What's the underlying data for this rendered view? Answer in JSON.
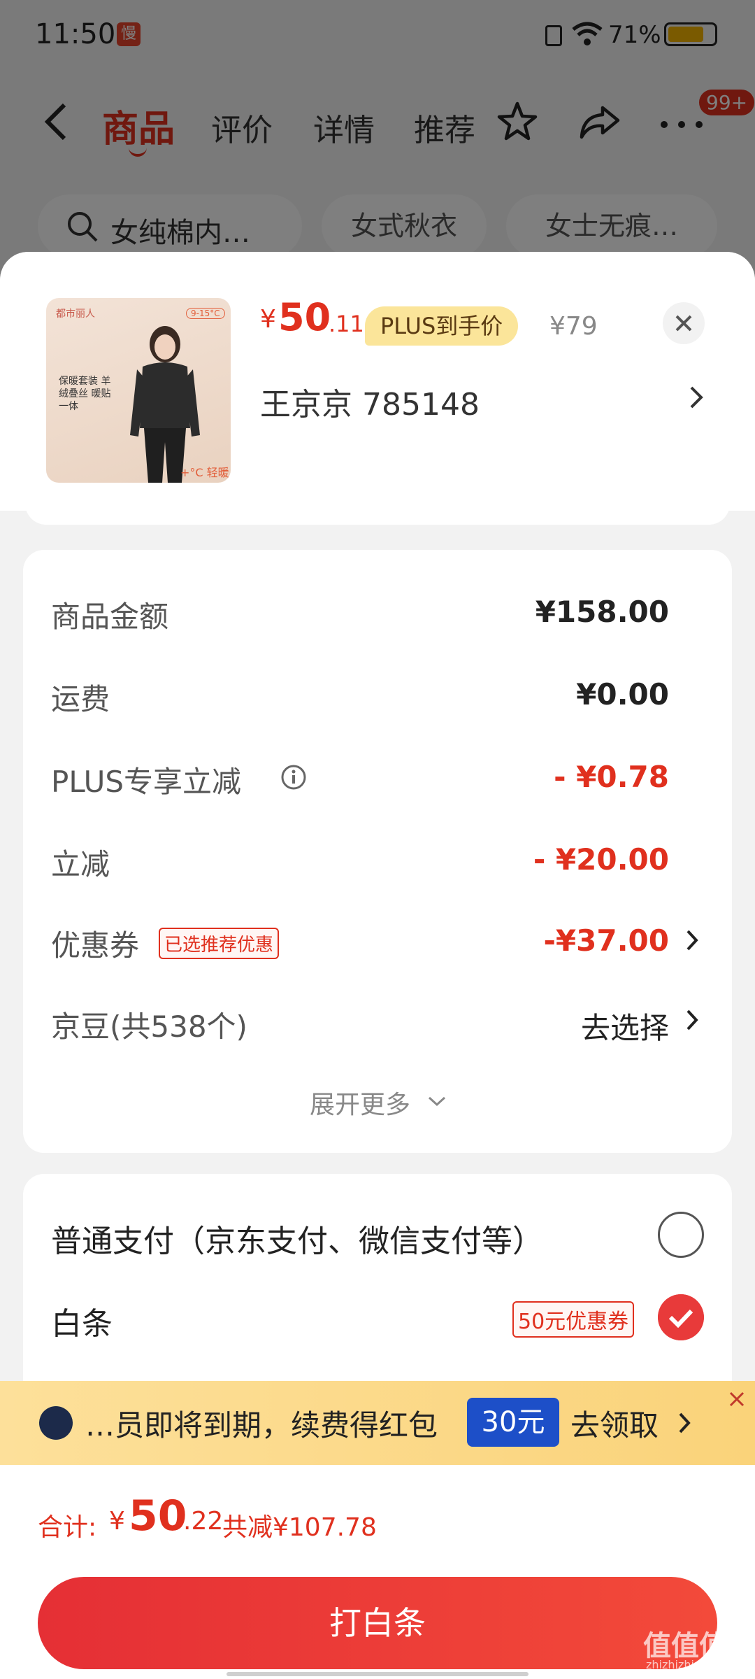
{
  "status_bar": {
    "time": "11:50",
    "badge": "慢",
    "battery": "71%"
  },
  "nav": {
    "tabs": [
      "商品",
      "评价",
      "详情",
      "推荐"
    ],
    "more_badge": "99+"
  },
  "search": {
    "query": "女纯棉内…",
    "chips": [
      "女式秋衣",
      "女士无痕…"
    ]
  },
  "product": {
    "thumb_brand": "都市丽人",
    "thumb_temp": "9-15°C",
    "thumb_tag": "保暖套装 羊绒叠丝 暖贴一体",
    "thumb_warm": "+°C 轻暖",
    "price_currency": "¥",
    "price_int": "50",
    "price_dec": ".11",
    "plus_badge": "PLUS到手价",
    "original_price": "¥79",
    "address": "王京京  785148"
  },
  "fees": {
    "goods_label": "商品金额",
    "goods_value": "¥158.00",
    "shipping_label": "运费",
    "shipping_value": "¥0.00",
    "plus_label": "PLUS专享立减",
    "plus_value": "- ¥0.78",
    "discount_label": "立减",
    "discount_value": "- ¥20.00",
    "coupon_label": "优惠券",
    "coupon_tag": "已选推荐优惠",
    "coupon_value": "-¥37.00",
    "jingdou_label": "京豆(共538个)",
    "jingdou_value": "去选择",
    "expand_more": "展开更多"
  },
  "payment": {
    "normal_label": "普通支付（京东支付、微信支付等）",
    "baitiao_label": "白条",
    "baitiao_coupon": "50元优惠券"
  },
  "banner": {
    "text": "…员即将到期，续费得红包",
    "amount": "30元",
    "cta": "去领取"
  },
  "footer": {
    "total_label": "合计:",
    "total_currency": "¥",
    "total_int": "50",
    "total_dec": ".22",
    "saved": "共减¥107.78",
    "pay_button": "打白条"
  },
  "watermark": {
    "text": "值值值",
    "sub": "zhizhizhi.com"
  },
  "colors": {
    "accent_red": "#e0301e",
    "plus_gold": "#fbe59a",
    "banner_blue": "#1d4fc8"
  }
}
